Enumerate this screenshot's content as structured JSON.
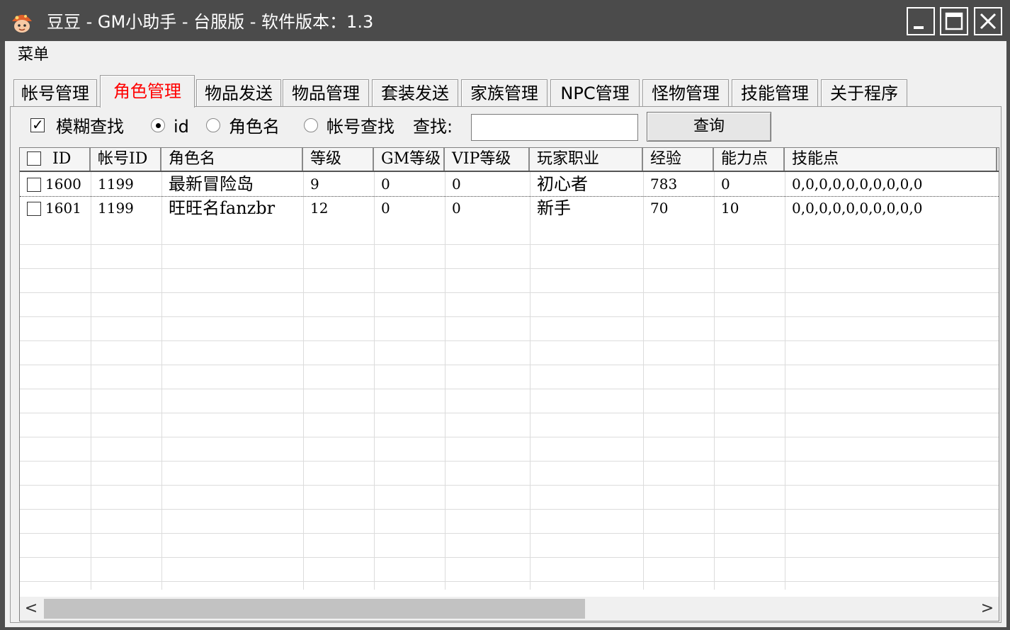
{
  "window": {
    "title": "豆豆 - GM小助手 - 台服版 - 软件版本：1.3",
    "icon": "mushroom-app-icon"
  },
  "menubar": {
    "menu_label": "菜单"
  },
  "tabs": [
    {
      "label": "帐号管理",
      "active": false
    },
    {
      "label": "角色管理",
      "active": true
    },
    {
      "label": "物品发送",
      "active": false
    },
    {
      "label": "物品管理",
      "active": false
    },
    {
      "label": "套装发送",
      "active": false
    },
    {
      "label": "家族管理",
      "active": false
    },
    {
      "label": "NPC管理",
      "active": false
    },
    {
      "label": "怪物管理",
      "active": false
    },
    {
      "label": "技能管理",
      "active": false
    },
    {
      "label": "关于程序",
      "active": false
    }
  ],
  "search": {
    "fuzzy_label": "模糊查找",
    "fuzzy_checked": true,
    "radio_id_label": "id",
    "radio_role_label": "角色名",
    "radio_account_label": "帐号查找",
    "selected_radio": "id",
    "find_label": "查找:",
    "input_value": "",
    "query_button": "查询"
  },
  "table": {
    "columns": [
      "ID",
      "帐号ID",
      "角色名",
      "等级",
      "GM等级",
      "VIP等级",
      "玩家职业",
      "经验",
      "能力点",
      "技能点"
    ],
    "rows": [
      [
        "1600",
        "1199",
        "最新冒险岛",
        "9",
        "0",
        "0",
        "初心者",
        "783",
        "0",
        "0,0,0,0,0,0,0,0,0,0"
      ],
      [
        "1601",
        "1199",
        "旺旺名fanzbr",
        "12",
        "0",
        "0",
        "新手",
        "70",
        "10",
        "0,0,0,0,0,0,0,0,0,0"
      ]
    ]
  },
  "scrollbar": {
    "left_arrow": "<",
    "right_arrow": ">"
  },
  "colors": {
    "active_tab_text": "#ff0000",
    "titlebar": "#4b4b4b",
    "client_bg": "#f0f0f0"
  }
}
